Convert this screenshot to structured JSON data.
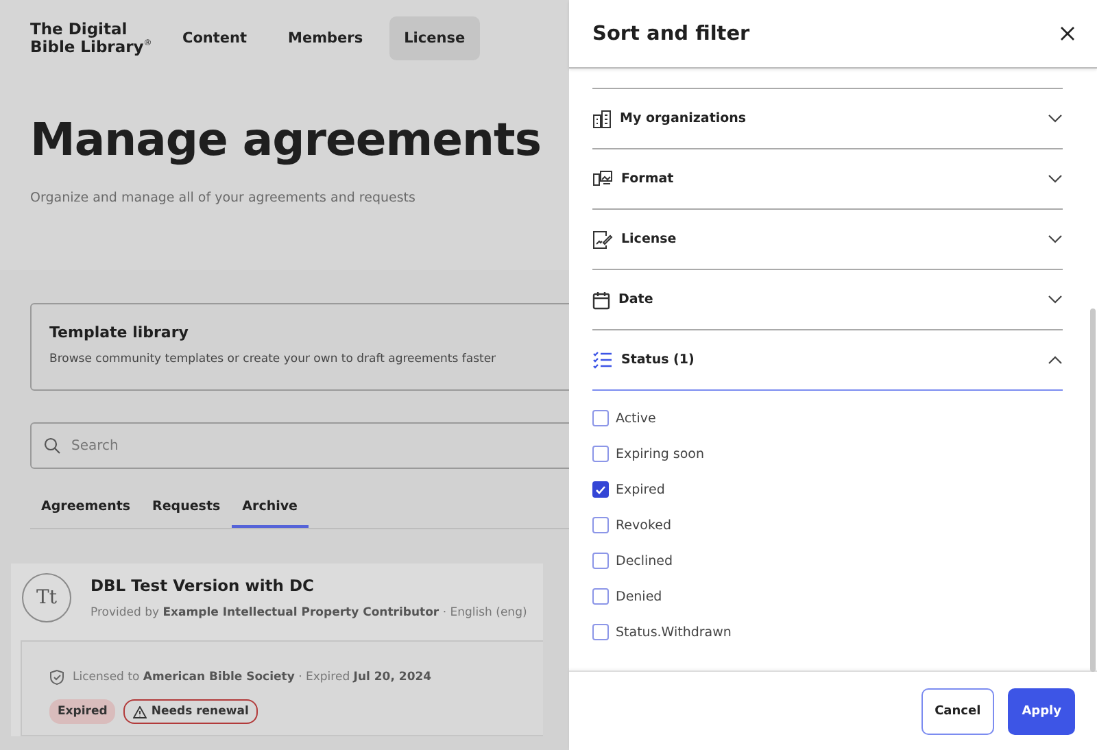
{
  "logo": "The Digital Bible Library$^{®}$",
  "nav": [
    {
      "label": "Content",
      "selected": false
    },
    {
      "label": "Members",
      "selected": false
    },
    {
      "label": "License",
      "selected": true
    }
  ],
  "title": "Manage agreements",
  "subtitle": "Organize and manage all of your agreements and requests",
  "template_card": {
    "title": "Template library",
    "description": "Browse community templates or create your own to draft agreements faster"
  },
  "search": {
    "placeholder": "Search"
  },
  "tabs": [
    {
      "label": "Agreements",
      "selected": false
    },
    {
      "label": "Requests",
      "selected": false
    },
    {
      "label": "Archive",
      "selected": true
    }
  ],
  "agreement": {
    "avatar": "Tt",
    "title": "DBL Test Version with DC",
    "provider": "Provided by **Example Intellectual Property Contributor** · English (eng)",
    "license": "Licensed to **American Bible Society** · Expired **Jul 20, 2024**",
    "badges": [
      {
        "label": "Expired",
        "kind": "status"
      },
      {
        "label": "Needs renewal",
        "kind": "warning"
      }
    ]
  },
  "panel": {
    "title": "Sort and filter",
    "sections": [
      {
        "label": "My organizations",
        "expanded": false
      },
      {
        "label": "Format",
        "expanded": false
      },
      {
        "label": "License",
        "expanded": false
      },
      {
        "label": "Date",
        "expanded": false
      },
      {
        "label": "Status (1)",
        "expanded": true
      }
    ],
    "options": [
      {
        "label": "Active",
        "checked": false
      },
      {
        "label": "Expiring soon",
        "checked": false
      },
      {
        "label": "Expired",
        "checked": true
      },
      {
        "label": "Revoked",
        "checked": false
      },
      {
        "label": "Declined",
        "checked": false
      },
      {
        "label": "Denied",
        "checked": false
      },
      {
        "label": "Status.Withdrawn",
        "checked": false
      }
    ],
    "buttons": [
      {
        "label": "Cancel",
        "kind": "secondary"
      },
      {
        "label": "Apply",
        "kind": "primary"
      }
    ]
  }
}
